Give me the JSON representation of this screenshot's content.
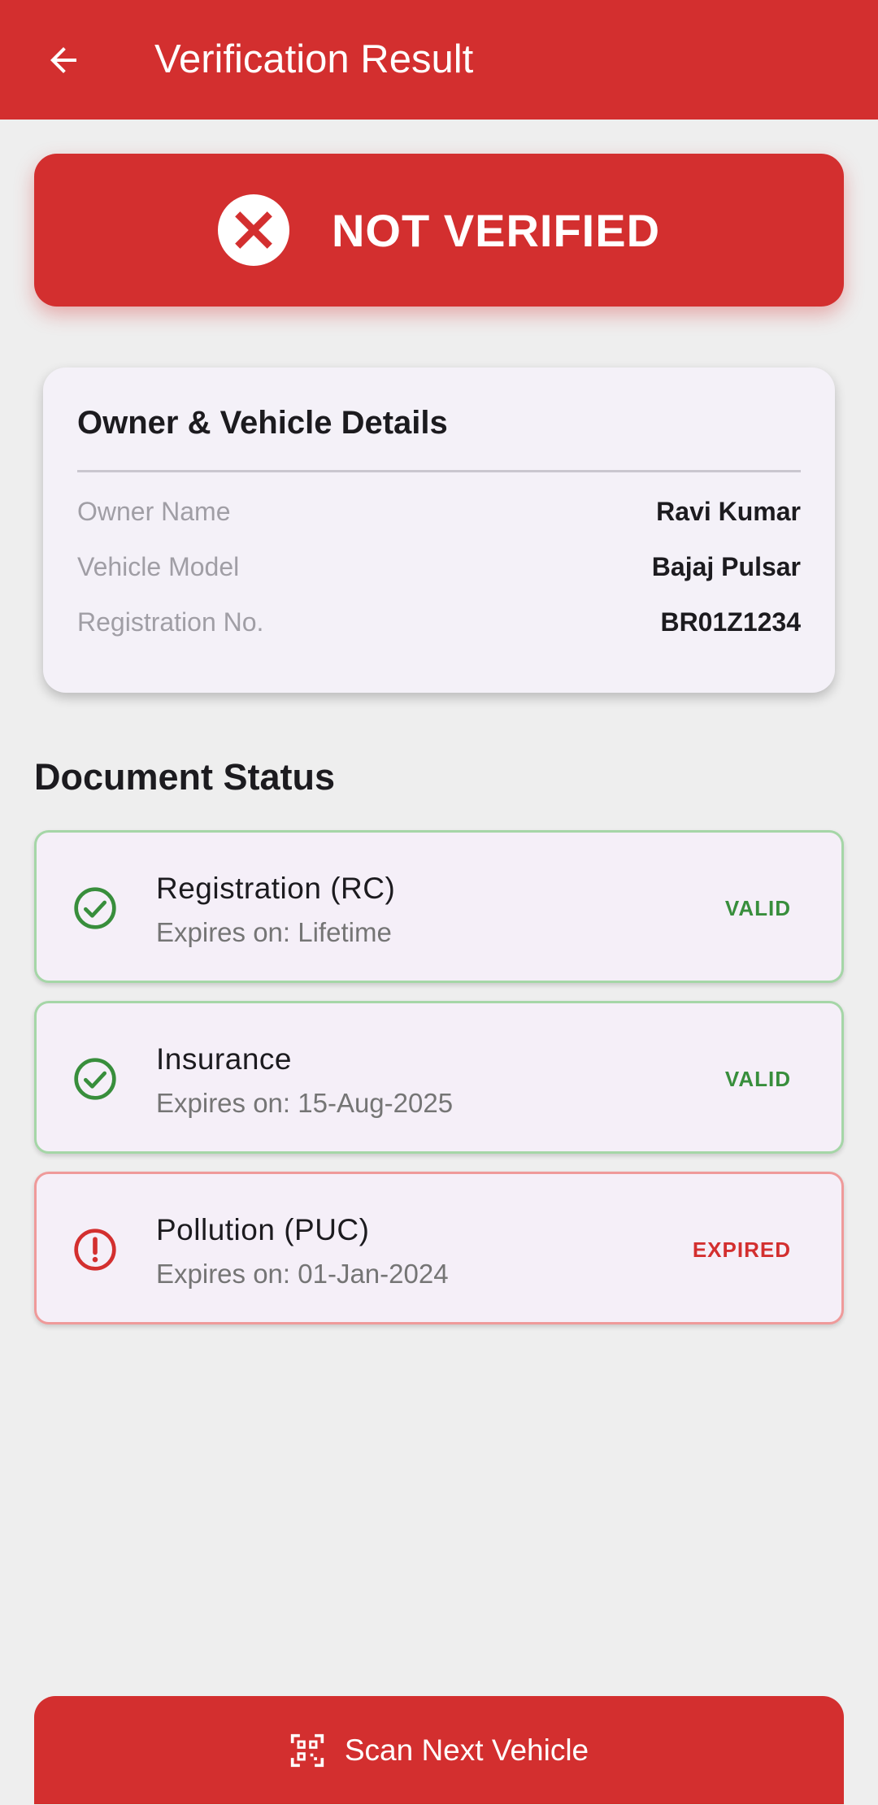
{
  "app_bar": {
    "title": "Verification Result",
    "back_icon": "arrow-back-icon",
    "color": "#d32f2f"
  },
  "status": {
    "label": "NOT VERIFIED",
    "icon": "close-circle-icon",
    "color": "#d32f2f"
  },
  "details": {
    "title": "Owner & Vehicle Details",
    "rows": [
      {
        "label": "Owner Name",
        "value": "Ravi Kumar"
      },
      {
        "label": "Vehicle Model",
        "value": "Bajaj Pulsar"
      },
      {
        "label": "Registration No.",
        "value": "BR01Z1234"
      }
    ]
  },
  "documents": {
    "title": "Document Status",
    "items": [
      {
        "name": "Registration (RC)",
        "expiry": "Expires on: Lifetime",
        "status": "VALID",
        "icon": "check-circle-icon",
        "color": "#388e3c"
      },
      {
        "name": "Insurance",
        "expiry": "Expires on: 15-Aug-2025",
        "status": "VALID",
        "icon": "check-circle-icon",
        "color": "#388e3c"
      },
      {
        "name": "Pollution (PUC)",
        "expiry": "Expires on: 01-Jan-2024",
        "status": "EXPIRED",
        "icon": "alert-circle-icon",
        "color": "#d32f2f"
      }
    ]
  },
  "action": {
    "label": "Scan Next Vehicle",
    "icon": "qr-scan-icon"
  }
}
